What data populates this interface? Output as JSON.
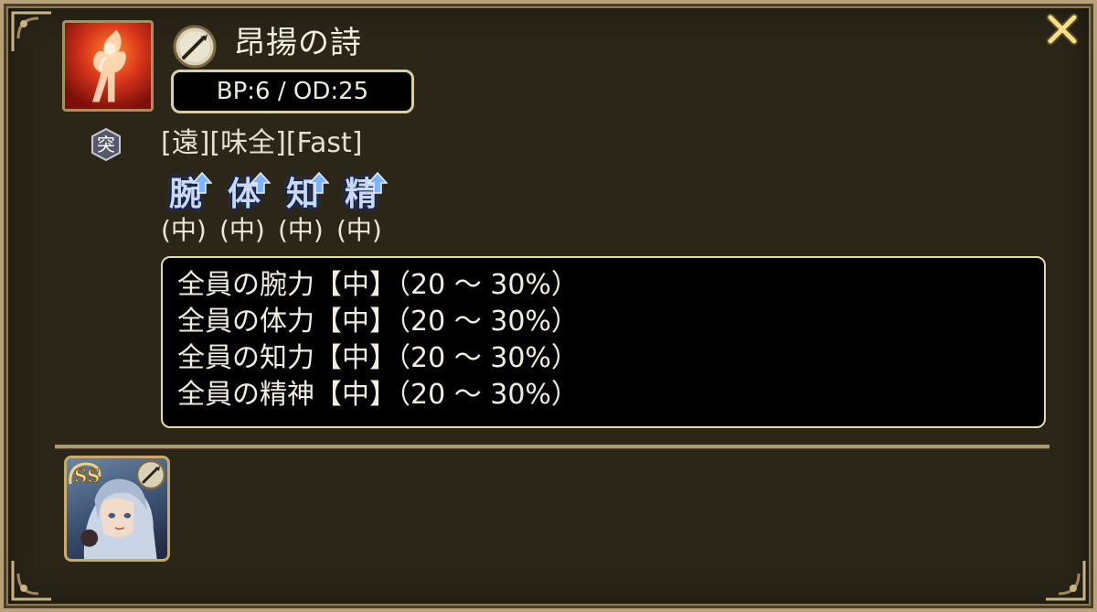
{
  "dialog": {
    "close_icon": "close-x-icon"
  },
  "skill": {
    "icon": "flame-figure-icon",
    "type_badge": "突",
    "weapon_icon": "spear-icon",
    "name": "昂揚の詩",
    "cost": "BP:6 / OD:25",
    "tags": "[遠][味全][Fast]",
    "stat_buffs": [
      {
        "stat": "腕",
        "level": "(中)",
        "direction_icon": "up-arrow-icon"
      },
      {
        "stat": "体",
        "level": "(中)",
        "direction_icon": "up-arrow-icon"
      },
      {
        "stat": "知",
        "level": "(中)",
        "direction_icon": "up-arrow-icon"
      },
      {
        "stat": "精",
        "level": "(中)",
        "direction_icon": "up-arrow-icon"
      }
    ],
    "description": [
      "全員の腕力【中】（20 〜 30%）",
      "全員の体力【中】（20 〜 30%）",
      "全員の知力【中】（20 〜 30%）",
      "全員の精神【中】（20 〜 30%）"
    ]
  },
  "owner": {
    "rank_icon": "ss-rank-icon",
    "weapon_icon": "spear-icon",
    "portrait": "character-portrait"
  },
  "colors": {
    "panel_bg": "#2b2618",
    "frame_gold": "#b7a27a",
    "text": "#ede8da",
    "stat_blue": "#c9d9f4",
    "arrow_blue": "#7fb4ff"
  }
}
